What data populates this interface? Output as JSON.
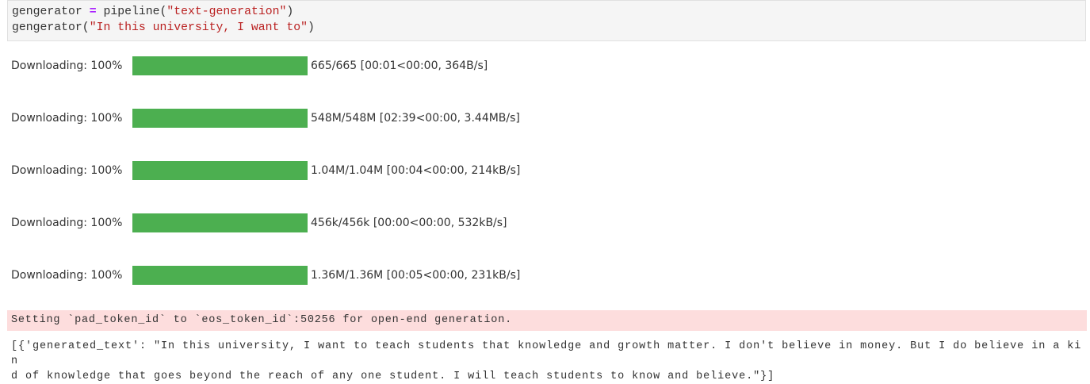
{
  "code_cell": {
    "line1": {
      "var": "gengerator",
      "op": "=",
      "fn": "pipeline(",
      "arg": "\"text-generation\"",
      "close": ")"
    },
    "line2": {
      "fn": "gengerator(",
      "arg": "\"In this university, I want to\"",
      "close": ")"
    }
  },
  "progress": [
    {
      "label": "Downloading: 100%",
      "percent": 100,
      "info": "665/665 [00:01<00:00, 364B/s]"
    },
    {
      "label": "Downloading: 100%",
      "percent": 100,
      "info": "548M/548M [02:39<00:00, 3.44MB/s]"
    },
    {
      "label": "Downloading: 100%",
      "percent": 100,
      "info": "1.04M/1.04M [00:04<00:00, 214kB/s]"
    },
    {
      "label": "Downloading: 100%",
      "percent": 100,
      "info": "456k/456k [00:00<00:00, 532kB/s]"
    },
    {
      "label": "Downloading: 100%",
      "percent": 100,
      "info": "1.36M/1.36M [00:05<00:00, 231kB/s]"
    }
  ],
  "bar_color": "#4caf50",
  "warning": "Setting `pad_token_id` to `eos_token_id`:50256 for open-end generation.",
  "output": {
    "line1": "[{'generated_text': \"In this university, I want to teach students that knowledge and growth matter. I don't believe in money. But I do believe in a kin",
    "line2": "d of knowledge that goes beyond the reach of any one student. I will teach students to know and believe.\"}]"
  }
}
